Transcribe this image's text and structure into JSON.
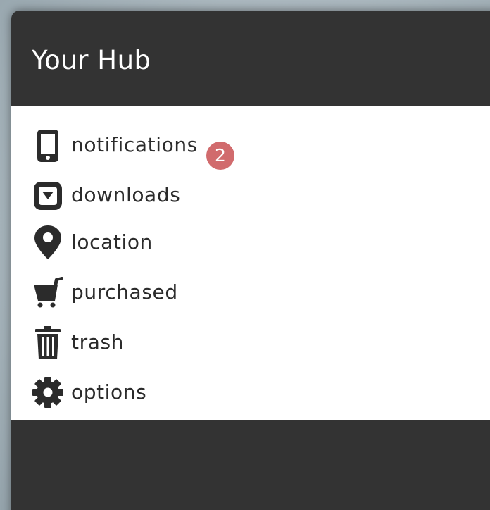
{
  "header": {
    "title": "Your Hub"
  },
  "menu": {
    "items": [
      {
        "label": "notifications",
        "icon": "phone-icon",
        "badge": "2"
      },
      {
        "label": "downloads",
        "icon": "download-box-icon"
      },
      {
        "label": "location",
        "icon": "map-pin-icon"
      },
      {
        "label": "purchased",
        "icon": "shopping-cart-icon"
      },
      {
        "label": "trash",
        "icon": "trash-icon"
      },
      {
        "label": "options",
        "icon": "gear-icon"
      }
    ]
  },
  "colors": {
    "panel_dark": "#333333",
    "menu_background": "#ffffff",
    "text": "#2b2b2b",
    "badge": "#d16b6d",
    "page_background": "#a9b6bd"
  }
}
